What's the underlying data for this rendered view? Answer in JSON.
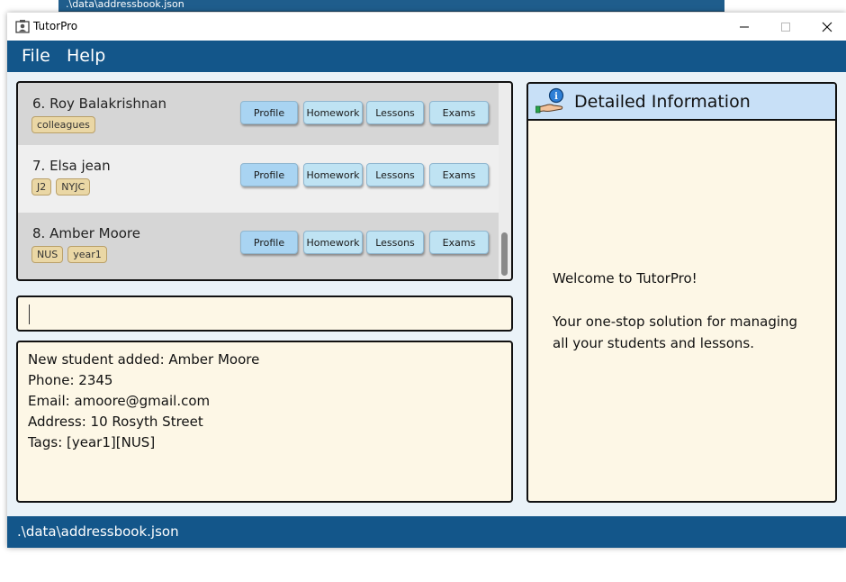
{
  "background_window": {
    "path": ".\\data\\addressbook.json"
  },
  "window": {
    "title": "TutorPro",
    "controls": {
      "minimize": "—",
      "maximize": "☐",
      "close": "✕"
    }
  },
  "menu": {
    "file": "File",
    "help": "Help"
  },
  "student_list": {
    "buttons": {
      "profile": "Profile",
      "homework": "Homework",
      "lessons": "Lessons",
      "exams": "Exams"
    },
    "students": [
      {
        "name": "6.  Roy Balakrishnan",
        "tags": [
          "colleagues"
        ]
      },
      {
        "name": "7.  Elsa jean",
        "tags": [
          "J2",
          "NYJC"
        ]
      },
      {
        "name": "8.  Amber Moore",
        "tags": [
          "NUS",
          "year1"
        ]
      }
    ]
  },
  "command_box": {
    "value": "",
    "placeholder": ""
  },
  "result": {
    "lines": [
      "New student added: Amber Moore",
      "Phone: 2345",
      "Email: amoore@gmail.com",
      "Address: 10 Rosyth Street",
      "Tags: [year1][NUS]"
    ]
  },
  "detail_panel": {
    "title": "Detailed Information",
    "welcome": "Welcome to TutorPro!",
    "tagline_line1": "Your one-stop solution for managing",
    "tagline_line2": "all your students and lessons."
  },
  "status_bar": {
    "path": ".\\data\\addressbook.json"
  },
  "colors": {
    "primary": "#13568a",
    "panel_bg": "#fdf7e6",
    "tag_bg": "#ead7a5",
    "button_bg": "#b9def5",
    "header_bg": "#c8e0f7"
  }
}
